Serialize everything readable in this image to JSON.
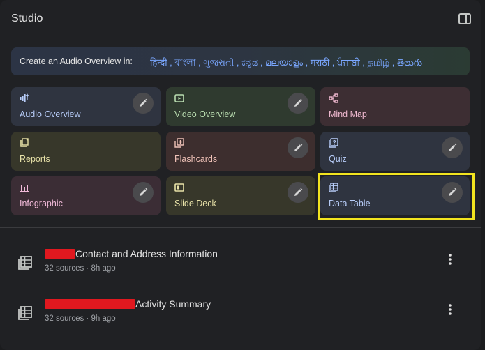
{
  "header": {
    "title": "Studio"
  },
  "banner": {
    "lead": "Create an Audio Overview in:",
    "languages": "हिन्दी , বাংলা , ગુજરાતી , ಕನ್ನಡ , മലയാളം , मराठी , ਪੰਜਾਬੀ , தமிழ் , తెలుగు"
  },
  "cards": [
    {
      "label": "Audio Overview",
      "icon": "audio-wave-icon",
      "bg": "#2f3440",
      "text": "#b8cdf9"
    },
    {
      "label": "Video Overview",
      "icon": "video-icon",
      "bg": "#2f3a2f",
      "text": "#b9dcb0"
    },
    {
      "label": "Mind Map",
      "icon": "mind-map-icon",
      "bg": "#3d2e33",
      "text": "#f0b9d0"
    },
    {
      "label": "Reports",
      "icon": "reports-icon",
      "bg": "#37372a",
      "text": "#e8e2a8"
    },
    {
      "label": "Flashcards",
      "icon": "flashcards-icon",
      "bg": "#3d2e2e",
      "text": "#f0c2b8"
    },
    {
      "label": "Quiz",
      "icon": "quiz-icon",
      "bg": "#2f3440",
      "text": "#b8cdf9"
    },
    {
      "label": "Infographic",
      "icon": "infographic-icon",
      "bg": "#3b2d35",
      "text": "#f0b9d8"
    },
    {
      "label": "Slide Deck",
      "icon": "slide-deck-icon",
      "bg": "#37372a",
      "text": "#e8e2a8"
    },
    {
      "label": "Data Table",
      "icon": "data-table-icon",
      "bg": "#2f3440",
      "text": "#b8cdf9"
    }
  ],
  "outputs": [
    {
      "title": "Contact and Address Information",
      "subtitle": "32 sources · 8h ago"
    },
    {
      "title": "Activity Summary",
      "subtitle": "32 sources · 9h ago"
    }
  ],
  "colors": {
    "highlight": "#f2e41f",
    "redaction": "#e0181f",
    "accent_link": "#7aa7ff"
  }
}
